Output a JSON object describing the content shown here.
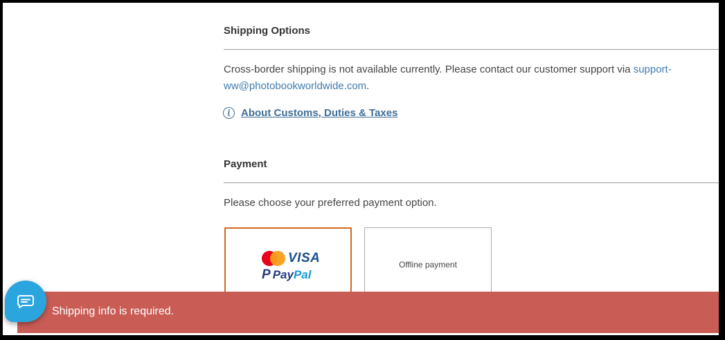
{
  "shipping": {
    "title": "Shipping Options",
    "message_prefix": "Cross-border shipping is not available currently. Please contact our customer support via ",
    "email_line1": "support-",
    "email_line2": "ww@photobookworldwide.com",
    "message_suffix": ".",
    "customs_link": "About Customs, Duties & Taxes"
  },
  "payment": {
    "title": "Payment",
    "instruction": "Please choose your preferred payment option.",
    "options": [
      {
        "brands": [
          "Mastercard",
          "VISA",
          "PayPal"
        ],
        "visa_label": "VISA",
        "paypal_pay": "Pay",
        "paypal_pal": "Pal",
        "selected": true
      },
      {
        "label": "Offline payment",
        "selected": false
      }
    ]
  },
  "toast": {
    "message": "Shipping info is required.",
    "color": "#c95d55"
  },
  "chat": {
    "icon": "chat-bubble-icon",
    "color": "#2aa5de"
  },
  "colors": {
    "link": "#3f7bb0",
    "selected_border": "#d2691e"
  }
}
